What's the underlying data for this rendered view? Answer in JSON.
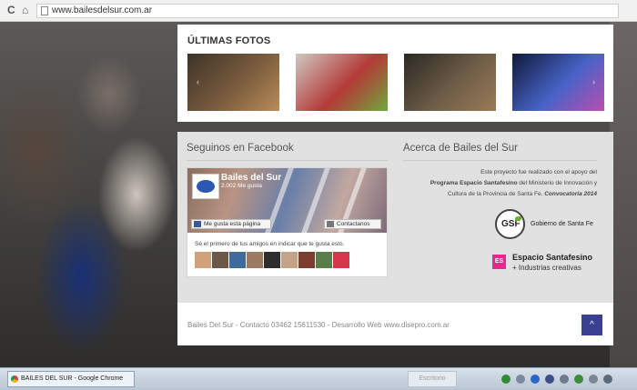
{
  "browser": {
    "url": "www.bailesdelsur.com.ar",
    "reload_icon": "C",
    "home_icon": "home-icon",
    "page_icon": "page-icon"
  },
  "photos": {
    "title": "ÚLTIMAS FOTOS",
    "thumbnails": [
      {
        "colors": [
          "#3d3328",
          "#7a5c3e",
          "#b98c5a"
        ]
      },
      {
        "colors": [
          "#cfc9c2",
          "#b33a38",
          "#6fa83c"
        ]
      },
      {
        "colors": [
          "#2a2824",
          "#6e5d48",
          "#9a7b57"
        ]
      },
      {
        "colors": [
          "#101a3a",
          "#4863c8",
          "#b84fae"
        ]
      }
    ]
  },
  "facebook": {
    "heading": "Seguinos en Facebook",
    "page_name": "Bailes del Sur",
    "likes": "2.002 Me gusta",
    "like_button": "Me gusta esta página",
    "contact_button": "Contactanos",
    "friends_text": "Sé el primero de tus amigos en indicar que te gusta esto.",
    "friend_faces": [
      "#d0a17b",
      "#6b5847",
      "#3e6a9e",
      "#9c7b62",
      "#2e2e2e",
      "#c4a488",
      "#7a3d2e",
      "#5a7d4a",
      "#d6354a"
    ]
  },
  "about": {
    "heading": "Acerca de Bailes del Sur",
    "line1": "Este proyecto fue realizado con el apoyo del",
    "program": "Programa Espacio Santafesino",
    "line2_rest": " del Ministerio de Innovación y",
    "line3": "Cultura de la Provincia de Santa Fe. ",
    "convocatoria": "Convocatoria 2014",
    "gsf": "GSF",
    "gobierno": "Gobierno de Santa Fe",
    "es_logo": "ES",
    "espacio": "Espacio Santafesino",
    "industrias": "+ Industrias creativas"
  },
  "footer": {
    "text": "Bailes Del Sur - Contacto 03462 15611530 - Desarrollo Web www.disepro.com.ar",
    "up_icon": "^"
  },
  "taskbar": {
    "task_label": "BAILES DEL SUR - Google Chrome",
    "desktop_label": "Escritorio",
    "tray_colors": [
      "#2f8d3a",
      "#7c8aa0",
      "#2a66c8",
      "#3b4f8a",
      "#6c7a8c",
      "#3d8c3a",
      "#7a8796",
      "#5b6b7c"
    ]
  }
}
